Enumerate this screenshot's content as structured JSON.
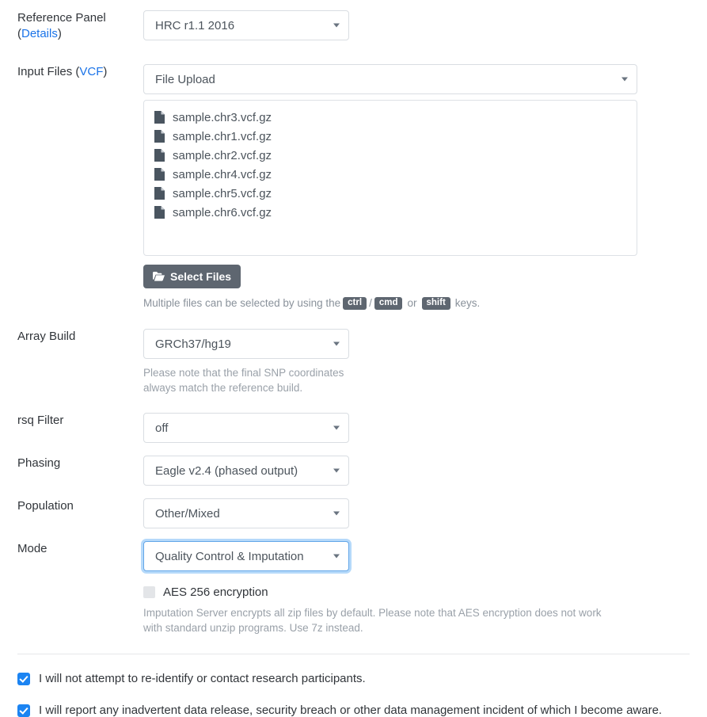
{
  "rows": {
    "reference_panel": {
      "label": "Reference Panel",
      "details_open": "(",
      "details_link": "Details",
      "details_close": ")",
      "value": "HRC r1.1 2016"
    },
    "input_files": {
      "label": "Input Files ",
      "paren_open": "(",
      "vcf_link": "VCF",
      "paren_close": ")",
      "value": "File Upload",
      "files": [
        "sample.chr3.vcf.gz",
        "sample.chr1.vcf.gz",
        "sample.chr2.vcf.gz",
        "sample.chr4.vcf.gz",
        "sample.chr5.vcf.gz",
        "sample.chr6.vcf.gz"
      ],
      "select_button": "Select Files",
      "help_prefix": "Multiple files can be selected by using the",
      "key_ctrl": "ctrl",
      "key_sep1": "/",
      "key_cmd": "cmd",
      "key_sep2": "or",
      "key_shift": "shift",
      "help_suffix": "keys."
    },
    "array_build": {
      "label": "Array Build",
      "value": "GRCh37/hg19",
      "note": "Please note that the final SNP coordinates always match the reference build."
    },
    "rsq_filter": {
      "label": "rsq Filter",
      "value": "off"
    },
    "phasing": {
      "label": "Phasing",
      "value": "Eagle v2.4 (phased output)"
    },
    "population": {
      "label": "Population",
      "value": "Other/Mixed"
    },
    "mode": {
      "label": "Mode",
      "value": "Quality Control & Imputation"
    },
    "aes": {
      "label": "AES 256 encryption",
      "note": "Imputation Server encrypts all zip files by default. Please note that AES encryption does not work with standard unzip programs. Use 7z instead."
    }
  },
  "consents": [
    "I will not attempt to re-identify or contact research participants.",
    "I will report any inadvertent data release, security breach or other data management incident of which I become aware."
  ],
  "colors": {
    "link": "#1a73e8",
    "checkbox_checked": "#1c84f2",
    "button_gray": "#5e6670",
    "focus_ring": "#63a6e8"
  }
}
